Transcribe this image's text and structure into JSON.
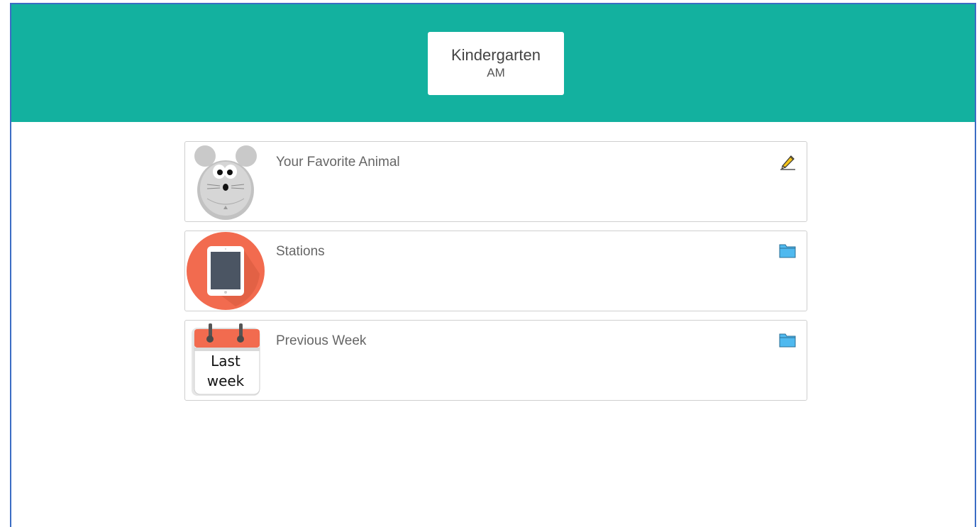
{
  "header": {
    "class_name": "Kindergarten",
    "class_session": "AM",
    "background_color": "#13b19f"
  },
  "items": [
    {
      "title": "Your Favorite Animal",
      "thumbnail": "mouse-timer-image",
      "action_icon": "pencil-icon"
    },
    {
      "title": "Stations",
      "thumbnail": "tablet-image",
      "action_icon": "folder-icon"
    },
    {
      "title": "Previous Week",
      "thumbnail": "calendar-image",
      "thumbnail_text": [
        "Last",
        "week"
      ],
      "action_icon": "folder-icon"
    }
  ],
  "colors": {
    "accent": "#13b19f",
    "folder": "#4fb9ef",
    "tablet_circle": "#f26b4f"
  }
}
